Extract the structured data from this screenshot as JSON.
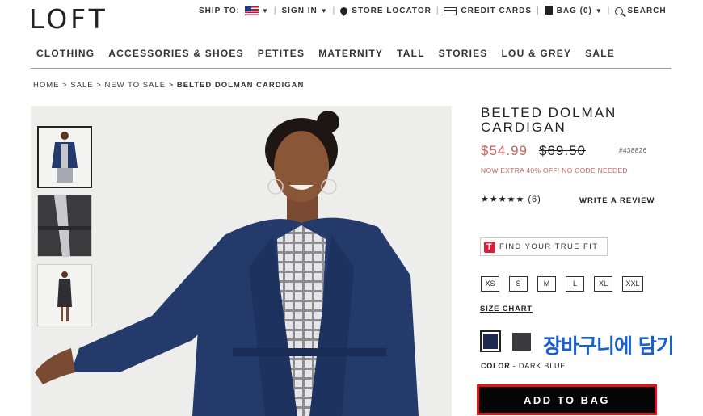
{
  "brand": {
    "logo": "LOFT"
  },
  "utility": {
    "ship_to": "SHIP TO:",
    "sign_in": "SIGN IN",
    "store_locator": "STORE LOCATOR",
    "credit_cards": "CREDIT CARDS",
    "bag": "BAG (0)",
    "search": "SEARCH"
  },
  "nav": {
    "items": [
      "CLOTHING",
      "ACCESSORIES & SHOES",
      "PETITES",
      "MATERNITY",
      "TALL",
      "STORIES",
      "LOU & GREY",
      "SALE"
    ]
  },
  "breadcrumb": {
    "links": [
      "HOME",
      "SALE",
      "NEW TO SALE"
    ],
    "separator": ">",
    "current": "BELTED DOLMAN CARDIGAN"
  },
  "product": {
    "title": "BELTED DOLMAN CARDIGAN",
    "price_sale": "$54.99",
    "price_original": "$69.50",
    "sku": "#438826",
    "promo": "NOW EXTRA 40% OFF! NO CODE NEEDED",
    "stars": "★★★★★",
    "review_count": "(6)",
    "write_review": "WRITE A REVIEW",
    "truefit_badge": "T",
    "truefit_label": "FIND YOUR TRUE FIT",
    "sizes": [
      "XS",
      "S",
      "M",
      "L",
      "XL",
      "XXL"
    ],
    "size_chart": "SIZE CHART",
    "color_label": "COLOR",
    "color_value": "DARK BLUE",
    "add_to_bag": "ADD TO BAG",
    "annotation": "장바구니에 담기"
  },
  "colors": {
    "sale_price": "#c8645e",
    "swatch_dark_blue": "#1d2a4e",
    "swatch_charcoal": "#3a3a3c",
    "cardigan": "#233a6b",
    "highlight_border": "#e0151b",
    "annotation": "#1a5fd0"
  }
}
